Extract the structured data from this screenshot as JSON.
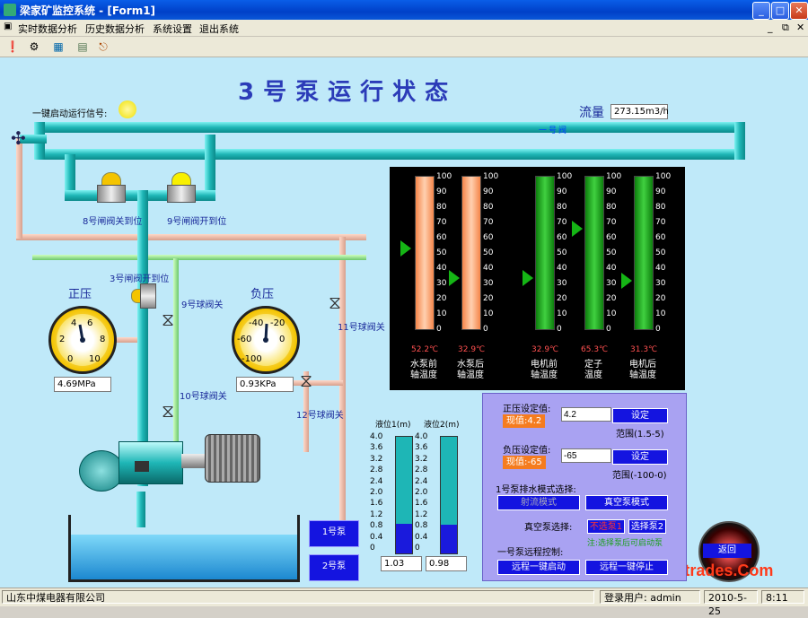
{
  "window": {
    "title": "梁家矿监控系统 - [Form1]",
    "controls": [
      "_",
      "□",
      "✕"
    ]
  },
  "menu": {
    "items": [
      "实时数据分析",
      "历史数据分析",
      "系统设置",
      "退出系统"
    ],
    "right_controls": [
      "_",
      "⧉",
      "✕"
    ]
  },
  "toolbar": {
    "icons": [
      "alarm-icon",
      "wrench-icon",
      "chart-icon",
      "report-icon",
      "exit-icon"
    ]
  },
  "page": {
    "title": "3号泵运行状态",
    "start_signal_label": "一键启动运行信号:",
    "flow_label": "流量",
    "flow_value": "273.15m3/h",
    "pipe_marker": "一号阀",
    "valves": {
      "v8": "8号闸阀关到位",
      "v9": "9号闸阀开到位",
      "v3": "3号闸阀开到位",
      "b9": "9号球阀关",
      "b10": "10号球阀关",
      "b11": "11号球阀关",
      "b12": "12号球阀关"
    },
    "pos_pressure": {
      "label": "正压",
      "value": "4.69MPa",
      "ticks": [
        "0",
        "2",
        "4",
        "6",
        "8",
        "10"
      ]
    },
    "neg_pressure": {
      "label": "负压",
      "value": "0.93KPa",
      "ticks": [
        "-100",
        "-80",
        "-60",
        "-40",
        "-20",
        "0"
      ]
    }
  },
  "temperatures": {
    "ticks": [
      "100",
      "90",
      "80",
      "70",
      "60",
      "50",
      "40",
      "30",
      "20",
      "10",
      "0"
    ],
    "columns": [
      {
        "name1": "水泵前",
        "name2": "轴温度",
        "value": "52.2℃",
        "level": 0.522,
        "color": "orange"
      },
      {
        "name1": "水泵后",
        "name2": "轴温度",
        "value": "32.9℃",
        "level": 0.329,
        "color": "orange"
      },
      {
        "name1": "电机前",
        "name2": "轴温度",
        "value": "32.9℃",
        "level": 0.329,
        "color": "green"
      },
      {
        "name1": "定子",
        "name2": "温度",
        "value": "65.3℃",
        "level": 0.653,
        "color": "green"
      },
      {
        "name1": "电机后",
        "name2": "轴温度",
        "value": "31.3℃",
        "level": 0.313,
        "color": "green"
      }
    ]
  },
  "levels": {
    "label1": "液位1(m)",
    "label2": "液位2(m)",
    "ticks": [
      "4.0",
      "3.6",
      "3.2",
      "2.8",
      "2.4",
      "2.0",
      "1.6",
      "1.2",
      "0.8",
      "0.4",
      "0"
    ],
    "value1": "1.03",
    "value2": "0.98",
    "fill1": 0.2575,
    "fill2": 0.245
  },
  "pumps": {
    "pump1": "1号泵",
    "pump2": "2号泵"
  },
  "control": {
    "pos_set_label": "正压设定值:",
    "pos_current_label": "现值:4.2",
    "pos_set_value": "4.2",
    "pos_set_button": "设定",
    "pos_range": "范围(1.5-5)",
    "neg_set_label": "负压设定值:",
    "neg_current_label": "现值:-65",
    "neg_set_value": "-65",
    "neg_set_button": "设定",
    "neg_range": "范围(-100-0)",
    "mode_label": "1号泵排水模式选择:",
    "mode_jet": "射流模式",
    "mode_vacuum": "真空泵模式",
    "vacuum_select_label": "真空泵选择:",
    "vacuum_no_select": "不选泵1",
    "vacuum_select2": "选择泵2",
    "vacuum_note": "注:选择泵后可启动泵",
    "remote_label": "一号泵远程控制:",
    "remote_start": "远程一键启动",
    "remote_stop": "远程一键停止"
  },
  "return_button": "返回",
  "watermark": "www.Cntrades.Com",
  "status": {
    "company": "山东中煤电器有限公司",
    "user_label": "登录用户:",
    "user": "admin",
    "date": "2010-5-25",
    "time": "8:11"
  },
  "colors": {
    "background": "#bfe9f9",
    "pipe": "#1eb6b6",
    "button_blue": "#1414e0",
    "panel": "#a9a2f2",
    "temp_orange": "#f5864a",
    "temp_green": "#18b418"
  }
}
